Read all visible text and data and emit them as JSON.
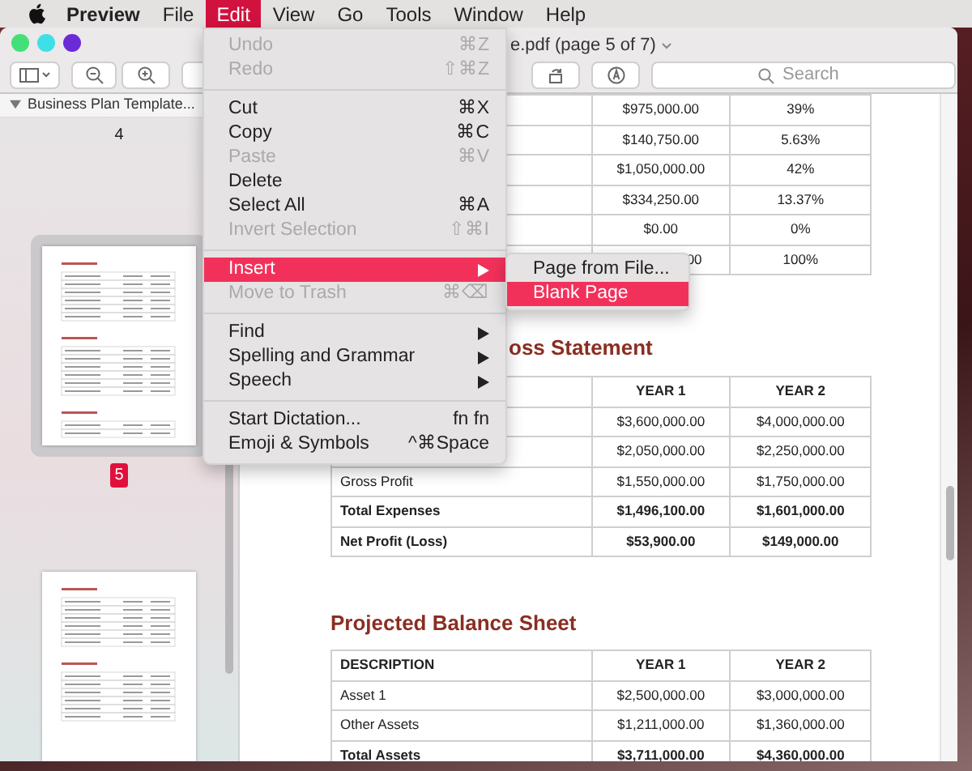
{
  "menu_bar": {
    "items": [
      {
        "label": "Preview",
        "kind": "app",
        "selected": false
      },
      {
        "label": "File",
        "kind": "menu",
        "selected": false
      },
      {
        "label": "Edit",
        "kind": "menu",
        "selected": true
      },
      {
        "label": "View",
        "kind": "menu",
        "selected": false
      },
      {
        "label": "Go",
        "kind": "menu",
        "selected": false
      },
      {
        "label": "Tools",
        "kind": "menu",
        "selected": false
      },
      {
        "label": "Window",
        "kind": "menu",
        "selected": false
      },
      {
        "label": "Help",
        "kind": "menu",
        "selected": false
      }
    ]
  },
  "window": {
    "title": "e.pdf (page 5 of 7)",
    "search": {
      "placeholder": "Search"
    }
  },
  "sidebar": {
    "group": {
      "label": "Business Plan Template...",
      "expanded": true
    },
    "pages": [
      {
        "kind": "label_only",
        "label": "4",
        "selected": false
      },
      {
        "kind": "full",
        "label": "5",
        "selected": true
      },
      {
        "kind": "thumbnail_only",
        "selected": false
      }
    ]
  },
  "document": {
    "sections": [
      {
        "table": {
          "rows": [
            {
              "bold": false,
              "cells": [
                null,
                "$975,000.00",
                "39%"
              ]
            },
            {
              "bold": false,
              "cells": [
                null,
                "$140,750.00",
                "5.63%"
              ]
            },
            {
              "bold": false,
              "cells": [
                null,
                "$1,050,000.00",
                "42%"
              ]
            },
            {
              "bold": false,
              "cells": [
                null,
                "$334,250.00",
                "13.37%"
              ]
            },
            {
              "bold": false,
              "cells": [
                null,
                "$0.00",
                "0%"
              ]
            },
            {
              "bold": false,
              "cells": [
                null,
                "00",
                "100%"
              ]
            }
          ]
        }
      },
      {
        "heading": {
          "text": "oss Statement",
          "clipped": true
        },
        "table": {
          "rows": [
            {
              "bold": true,
              "cells": [
                null,
                "YEAR 1",
                "YEAR 2"
              ]
            },
            {
              "bold": false,
              "cells": [
                null,
                "$3,600,000.00",
                "$4,000,000.00"
              ]
            },
            {
              "bold": false,
              "cells": [
                null,
                "$2,050,000.00",
                "$2,250,000.00"
              ]
            },
            {
              "bold": false,
              "cells": [
                "Gross Profit",
                "$1,550,000.00",
                "$1,750,000.00"
              ]
            },
            {
              "bold": true,
              "cells": [
                "Total Expenses",
                "$1,496,100.00",
                "$1,601,000.00"
              ]
            },
            {
              "bold": true,
              "cells": [
                "Net Profit (Loss)",
                "$53,900.00",
                "$149,000.00"
              ]
            }
          ]
        }
      },
      {
        "heading": {
          "text": "Projected Balance Sheet"
        },
        "table": {
          "rows": [
            {
              "bold": true,
              "cells": [
                "DESCRIPTION",
                "YEAR 1",
                "YEAR 2"
              ]
            },
            {
              "bold": false,
              "cells": [
                "Asset 1",
                "$2,500,000.00",
                "$3,000,000.00"
              ]
            },
            {
              "bold": false,
              "cells": [
                "Other Assets",
                "$1,211,000.00",
                "$1,360,000.00"
              ]
            },
            {
              "bold": true,
              "cells": [
                "Total Assets",
                "$3,711,000.00",
                "$4,360,000.00"
              ]
            }
          ]
        }
      }
    ]
  },
  "edit_menu": {
    "items": [
      {
        "kind": "item",
        "label": "Undo",
        "shortcut": "⌘Z",
        "disabled": true,
        "selected": false,
        "has_submenu": false
      },
      {
        "kind": "item",
        "label": "Redo",
        "shortcut": "⇧⌘Z",
        "disabled": true,
        "selected": false,
        "has_submenu": false
      },
      {
        "kind": "separator"
      },
      {
        "kind": "item",
        "label": "Cut",
        "shortcut": "⌘X",
        "disabled": false,
        "selected": false,
        "has_submenu": false
      },
      {
        "kind": "item",
        "label": "Copy",
        "shortcut": "⌘C",
        "disabled": false,
        "selected": false,
        "has_submenu": false
      },
      {
        "kind": "item",
        "label": "Paste",
        "shortcut": "⌘V",
        "disabled": true,
        "selected": false,
        "has_submenu": false
      },
      {
        "kind": "item",
        "label": "Delete",
        "disabled": false,
        "selected": false,
        "has_submenu": false
      },
      {
        "kind": "item",
        "label": "Select All",
        "shortcut": "⌘A",
        "disabled": false,
        "selected": false,
        "has_submenu": false
      },
      {
        "kind": "item",
        "label": "Invert Selection",
        "shortcut": "⇧⌘I",
        "disabled": true,
        "selected": false,
        "has_submenu": false
      },
      {
        "kind": "separator"
      },
      {
        "kind": "item",
        "label": "Insert",
        "disabled": false,
        "selected": true,
        "has_submenu": true
      },
      {
        "kind": "item",
        "label": "Move to Trash",
        "shortcut": "⌘⌫",
        "disabled": true,
        "selected": false,
        "has_submenu": false
      },
      {
        "kind": "separator"
      },
      {
        "kind": "item",
        "label": "Find",
        "disabled": false,
        "selected": false,
        "has_submenu": true
      },
      {
        "kind": "item",
        "label": "Spelling and Grammar",
        "disabled": false,
        "selected": false,
        "has_submenu": true
      },
      {
        "kind": "item",
        "label": "Speech",
        "disabled": false,
        "selected": false,
        "has_submenu": true
      },
      {
        "kind": "separator"
      },
      {
        "kind": "item",
        "label": "Start Dictation...",
        "shortcut": "fn fn",
        "disabled": false,
        "selected": false,
        "has_submenu": false
      },
      {
        "kind": "item",
        "label": "Emoji & Symbols",
        "shortcut": "^⌘Space",
        "disabled": false,
        "selected": false,
        "has_submenu": false
      }
    ]
  },
  "insert_submenu": {
    "items": [
      {
        "label": "Page from File...",
        "selected": false
      },
      {
        "label": "Blank Page",
        "selected": true
      }
    ]
  }
}
